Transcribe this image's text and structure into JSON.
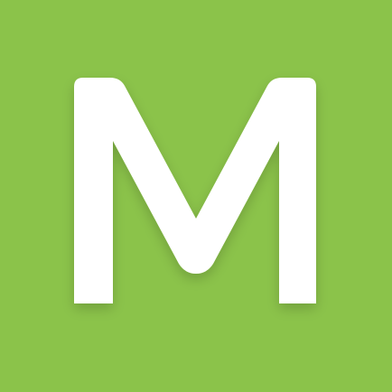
{
  "app_icon": {
    "logo_letter": "M",
    "background_color": "#8bc34a",
    "glyph_color": "#ffffff",
    "icon_name": "m-logo-icon"
  }
}
